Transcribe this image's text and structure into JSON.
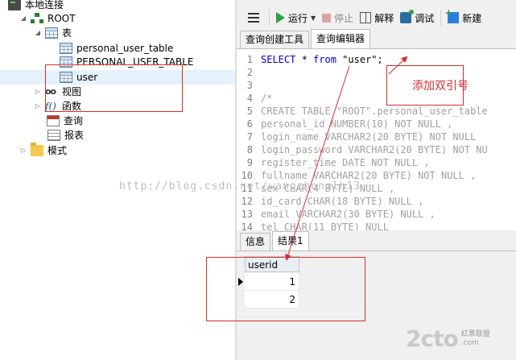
{
  "tree": {
    "connection": "本地连接",
    "schema": "ROOT",
    "tables_group": "表",
    "tables": [
      "personal_user_table",
      "PERSONAL_USER_TABLE",
      "user"
    ],
    "views": "视图",
    "functions": "函数",
    "queries": "查询",
    "reports": "报表",
    "models": "模式"
  },
  "toolbar": {
    "run": "运行",
    "stop": "停止",
    "explain": "解释",
    "debug": "调试",
    "new": "新建"
  },
  "editor_tabs": [
    "查询创建工具",
    "查询编辑器"
  ],
  "editor": {
    "line_numbers": [
      "1",
      "2",
      "3",
      "4",
      "5",
      "6",
      "7",
      "8",
      "9",
      "10",
      "11",
      "12",
      "13",
      "14"
    ],
    "line1_kw1": "SELECT",
    "line1_mid": " * ",
    "line1_kw2": "from",
    "line1_str": " \"user\";",
    "comment_lines": [
      "/*",
      "CREATE TABLE \"ROOT\".personal_user_table",
      "personal_id NUMBER(10) NOT NULL ,",
      "login_name VARCHAR2(20 BYTE) NOT NULL",
      "login_password VARCHAR2(20 BYTE) NOT NU",
      "register_time DATE NOT NULL ,",
      "fullname VARCHAR2(20 BYTE) NOT NULL ,",
      "sex CHAR(4 BYTE) NULL ,",
      "id_card CHAR(18 BYTE) NULL ,",
      "email VARCHAR2(30 BYTE) NULL ,",
      "tel CHAR(11 BYTE) NULL"
    ]
  },
  "results_tabs": [
    "信息",
    "结果1"
  ],
  "grid": {
    "column": "userid",
    "rows": [
      "1",
      "2"
    ]
  },
  "annotation": "添加双引号",
  "watermark": "http://blog.csdn.net/wangzhonglh13",
  "logo": {
    "big": "2cto",
    "small_top": "红黑联盟",
    "small_bottom": ".com"
  },
  "colors": {
    "keyword": "#0000cc",
    "comment": "#a0a0a0",
    "annotation": "#d32f2f"
  }
}
